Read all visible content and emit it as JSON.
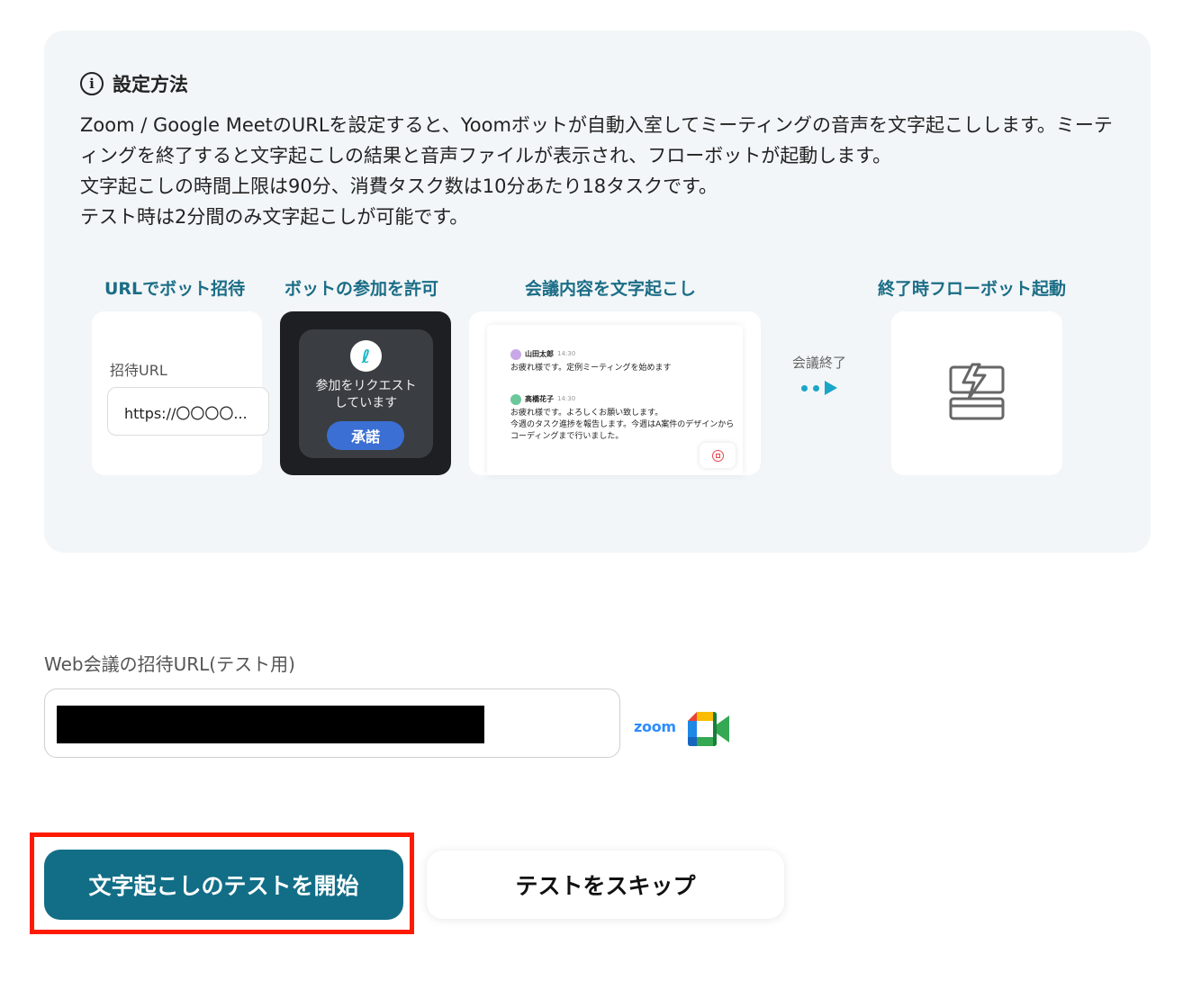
{
  "info": {
    "title": "設定方法",
    "lines": [
      "Zoom / Google MeetのURLを設定すると、Yoomボットが自動入室してミーティングの音声を文字起こしします。ミーティングを終了すると文字起こしの結果と音声ファイルが表示され、フローボットが起動します。",
      "文字起こしの時間上限は90分、消費タスク数は10分あたり18タスクです。",
      "テスト時は2分間のみ文字起こしが可能です。"
    ]
  },
  "steps": {
    "step1": {
      "title": "URLでボット招待",
      "field_label": "招待URL",
      "field_value": "https://〇〇〇〇..."
    },
    "step2": {
      "title": "ボットの参加を許可",
      "logo": "ℓ",
      "request_text": "参加をリクエスト\nしています",
      "approve_label": "承諾"
    },
    "step3": {
      "title": "会議内容を文字起こし",
      "messages": [
        {
          "name": "山田太郎",
          "time": "14:30",
          "text": "お疲れ様です。定例ミーティングを始めます",
          "avatar": "山",
          "color": "#c9a8e8"
        },
        {
          "name": "高橋花子",
          "time": "14:30",
          "text": "お疲れ様です。よろしくお願い致します。\n今週のタスク進捗を報告します。今週はA案件のデザインからコーディングまで行いました。",
          "avatar": "高",
          "color": "#6cc79a"
        }
      ]
    },
    "arrow_label": "会議終了",
    "step4": {
      "title": "終了時フローボット起動",
      "icon": "flowbot-icon"
    }
  },
  "form": {
    "label": "Web会議の招待URL(テスト用)",
    "value": "",
    "zoom_logo": "zoom",
    "meet_logo": "google-meet-icon"
  },
  "buttons": {
    "start": "文字起こしのテストを開始",
    "skip": "テストをスキップ"
  },
  "colors": {
    "accent": "#126e86",
    "step_title": "#1b6d86",
    "highlight": "#ff1a00",
    "panel_bg": "#f2f6f8"
  }
}
